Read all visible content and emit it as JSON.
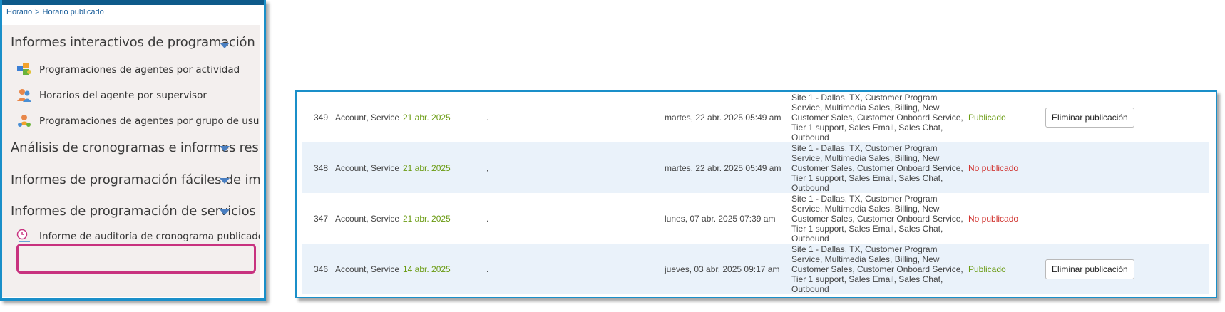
{
  "breadcrumb": {
    "root": "Horario",
    "separator": ">",
    "current": "Horario publicado"
  },
  "menu": {
    "section1": {
      "title": "Informes interactivos de programación"
    },
    "items": [
      {
        "label": "Programaciones de agentes por actividad",
        "icon": "puzzle-icon"
      },
      {
        "label": "Horarios del agente por supervisor",
        "icon": "people-icon"
      },
      {
        "label": "Programaciones de agentes por grupo de usuar",
        "icon": "group-icon"
      }
    ],
    "section2": {
      "title": "Análisis de cronogramas e informes resumic"
    },
    "section3": {
      "title": "Informes de programación fáciles de imprim"
    },
    "section4": {
      "title": "Informes de programación de servicios públ"
    },
    "audit_item": {
      "label": "Informe de auditoría de cronograma publicado",
      "icon": "clock-icon"
    }
  },
  "colors": {
    "accent_blue": "#1a8fc9",
    "published_green": "#6a9b12",
    "unpublished_red": "#d0312d",
    "highlight_magenta": "#c8327f"
  },
  "table": {
    "rows": [
      {
        "id": "349",
        "type": "Account, Service",
        "date": "21 abr. 2025",
        "punct": ".",
        "published_on": "martes, 22 abr. 2025 05:49 am",
        "sites": "Site 1 - Dallas, TX, Customer Program Service, Multimedia Sales, Billing, New Customer Sales, Customer Onboard Service, Tier 1 support, Sales Email, Sales Chat, Outbound",
        "status": "Publicado",
        "action": "Eliminar publicación"
      },
      {
        "id": "348",
        "type": "Account, Service",
        "date": "21 abr. 2025",
        "punct": ",",
        "published_on": "martes, 22 abr. 2025 05:49 am",
        "sites": "Site 1 - Dallas, TX, Customer Program Service, Multimedia Sales, Billing, New Customer Sales, Customer Onboard Service, Tier 1 support, Sales Email, Sales Chat, Outbound",
        "status": "No publicado",
        "action": ""
      },
      {
        "id": "347",
        "type": "Account, Service",
        "date": "21 abr. 2025",
        "punct": ".",
        "published_on": "lunes, 07 abr. 2025 07:39 am",
        "sites": "Site 1 - Dallas, TX, Customer Program Service, Multimedia Sales, Billing, New Customer Sales, Customer Onboard Service, Tier 1 support, Sales Email, Sales Chat, Outbound",
        "status": "No publicado",
        "action": ""
      },
      {
        "id": "346",
        "type": "Account, Service",
        "date": "14 abr. 2025",
        "punct": ".",
        "published_on": "jueves, 03 abr. 2025 09:17 am",
        "sites": "Site 1 - Dallas, TX, Customer Program Service, Multimedia Sales, Billing, New Customer Sales, Customer Onboard Service, Tier 1 support, Sales Email, Sales Chat, Outbound",
        "status": "Publicado",
        "action": "Eliminar publicación"
      }
    ]
  }
}
